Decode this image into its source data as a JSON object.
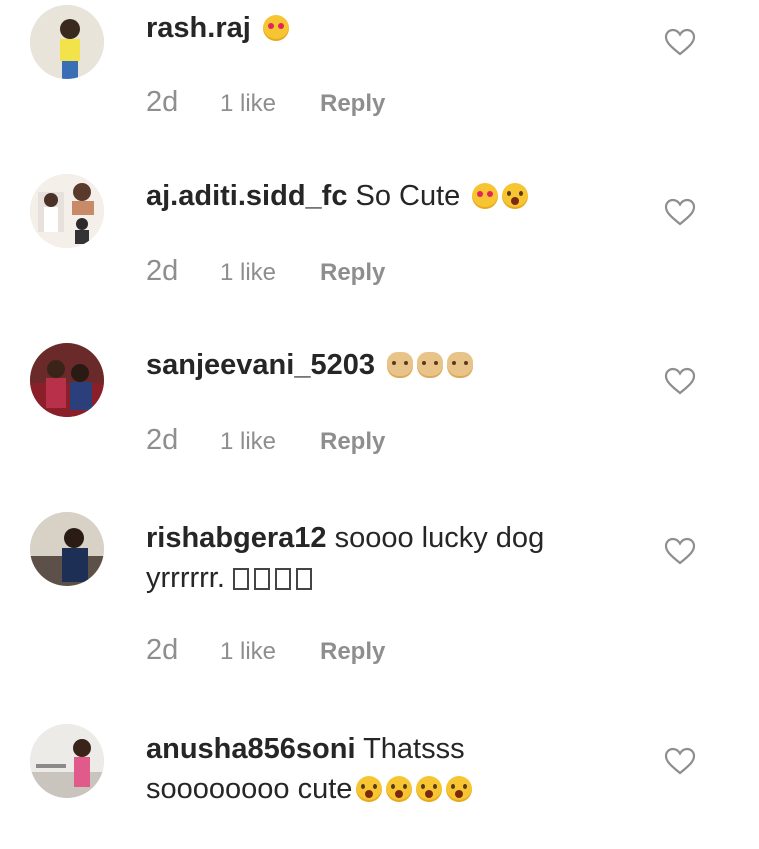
{
  "comments": [
    {
      "username": "rash.raj",
      "text": "",
      "emojis": [
        "heart-eyes"
      ],
      "age": "2d",
      "likes": "1 like",
      "reply": "Reply"
    },
    {
      "username": "aj.aditi.sidd_fc",
      "text": "So Cute",
      "emojis": [
        "heart-eyes",
        "kissing-face"
      ],
      "age": "2d",
      "likes": "1 like",
      "reply": "Reply"
    },
    {
      "username": "sanjeevani_5203",
      "text": "",
      "emojis": [
        "dog-face",
        "dog-face",
        "dog-face"
      ],
      "age": "2d",
      "likes": "1 like",
      "reply": "Reply"
    },
    {
      "username": "rishabgera12",
      "text": "soooo lucky dog yrrrrrr.",
      "emojis": [
        "missing-glyph",
        "missing-glyph",
        "missing-glyph",
        "missing-glyph"
      ],
      "age": "2d",
      "likes": "1 like",
      "reply": "Reply"
    },
    {
      "username": "anusha856soni",
      "text": "Thatsss soooooooo cute",
      "emojis": [
        "kissing-face",
        "kissing-face",
        "kissing-face",
        "kissing-face"
      ],
      "age": "",
      "likes": "",
      "reply": ""
    }
  ],
  "colors": {
    "text": "#262626",
    "meta": "#8e8e8e",
    "heart_outline": "#8e8e8e",
    "emoji_yellow": "#f7c531"
  }
}
